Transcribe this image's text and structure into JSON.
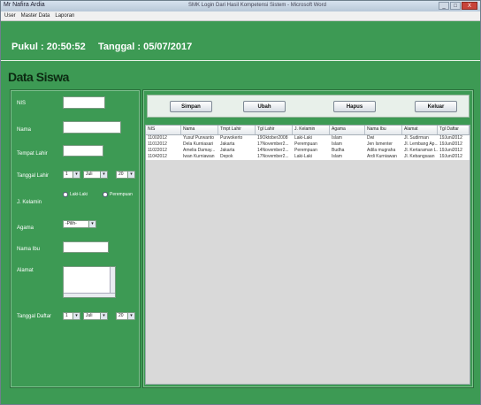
{
  "window": {
    "title": "Mr Nafira Ardia",
    "document_title": "SMK Login Dari Hasil Kompetensi Sistem - Microsoft Word",
    "buttons": [
      "_",
      "□",
      "X"
    ]
  },
  "menu": [
    "User",
    "Master Data",
    "Laporan"
  ],
  "header": {
    "time_label": "Pukul : 20:50:52",
    "date_label": "Tanggal : 05/07/2017"
  },
  "page_title": "Data Siswa",
  "form": {
    "nis_label": "NIS",
    "nama_label": "Nama",
    "tempat_lahir_label": "Tempat Lahir",
    "tanggal_lahir_label": "Tanggal Lahir",
    "tanggal_lahir_day": "1",
    "tanggal_lahir_month": "Juli",
    "tanggal_lahir_year": "20",
    "jk_label": "J. Kelamin",
    "jk_options": [
      "Laki-Laki",
      "Perempuan"
    ],
    "agama_label": "Agama",
    "agama_value": "-Pilih-",
    "nama_ibu_label": "Nama Ibu",
    "alamat_label": "Alamat",
    "tanggal_daftar_label": "Tanggal Daftar",
    "tanggal_daftar_day": "1",
    "tanggal_daftar_month": "Juli",
    "tanggal_daftar_year": "20"
  },
  "buttons": {
    "simpan": "Simpan",
    "ubah": "Ubah",
    "hapus": "Hapus",
    "keluar": "Keluar"
  },
  "table": {
    "columns": [
      "NIS",
      "Nama",
      "Tmpt Lahir",
      "Tgl Lahir",
      "J. Kelamin",
      "Agama",
      "Nama Ibu",
      "Alamat",
      "Tgl Daftar"
    ],
    "rows": [
      [
        "11002012",
        "Yusuf Purwanto",
        "Purwokerto",
        "19Oktober2008",
        "Laki-Laki",
        "Islam",
        "Dwi",
        "Jl. Sudirman",
        "19Juni2012"
      ],
      [
        "11012012",
        "Dela Kurniasari",
        "Jakarta",
        "17November2...",
        "Perempuan",
        "Islam",
        "Jen Ismenter",
        "Jl. Lembang Ap...",
        "19Juni2012"
      ],
      [
        "11022012",
        "Amelia Damay...",
        "Jakarta",
        "14November2...",
        "Perempuan",
        "Budha",
        "Adila mugraha",
        "Jl. Kertaraman L...",
        "19Juni2012"
      ],
      [
        "11042012",
        "Iwan Kurniawan",
        "Depok",
        "17November2...",
        "Laki-Laki",
        "Islam",
        "Ardi Kurniawan",
        "Jl. Kebangsaan",
        "19Juni2012"
      ]
    ]
  },
  "colors": {
    "background": "#3d9a54",
    "panel_border": "#2b6e3b",
    "table_empty": "#d9d9d9"
  }
}
